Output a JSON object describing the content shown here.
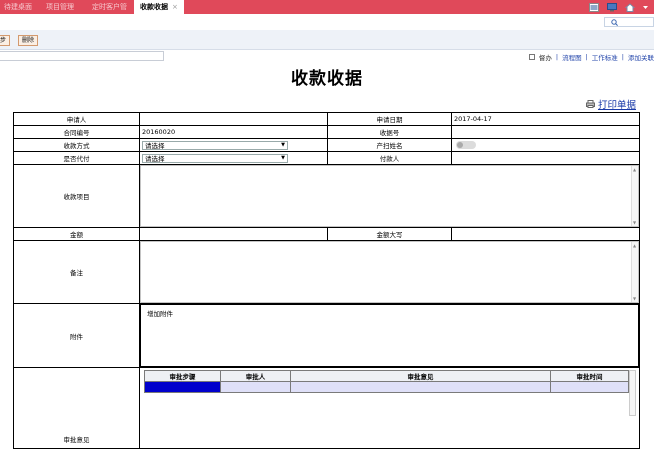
{
  "tabs": [
    {
      "label": "待建桌面"
    },
    {
      "label": "项目管理"
    },
    {
      "label": "定时客户管"
    },
    {
      "label": "收款收据",
      "active": true,
      "close": "×"
    }
  ],
  "toolbar": {
    "btn1": "步",
    "btn2": "删除"
  },
  "rightlinks": {
    "check": "督办",
    "flow": "流程图",
    "standard": "工作标准",
    "addrel": "添加关联"
  },
  "title": "收款收据",
  "print_link": "打印单据",
  "form": {
    "applicant_label": "申请人",
    "applicant_value": "",
    "apply_date_label": "申请日期",
    "apply_date_value": "2017-04-17",
    "contract_label": "合同编号",
    "contract_value": "20160020",
    "receipt_no_label": "收据号",
    "receipt_no_value": "",
    "pay_method_label": "收款方式",
    "pay_method_value": "请选择",
    "sweeper_label": "产扫姓名",
    "proxy_label": "是否代付",
    "proxy_value": "请选择",
    "payer_label": "付款人",
    "payer_value": "",
    "items_label": "收款项目",
    "amount_label": "金额",
    "amount_value": "",
    "amount_caps_label": "金额大写",
    "amount_caps_value": "",
    "remark_label": "备注",
    "attach_label": "附件",
    "attach_add": "增加附件",
    "approval_label": "审批意见"
  },
  "approval_grid": {
    "headers": [
      "审批步骤",
      "审批人",
      "审批意见",
      "审批时间"
    ]
  },
  "colors": {
    "tabbar": "#e0495a",
    "selected_cell": "#0000cc",
    "link": "#1a3aa8"
  }
}
